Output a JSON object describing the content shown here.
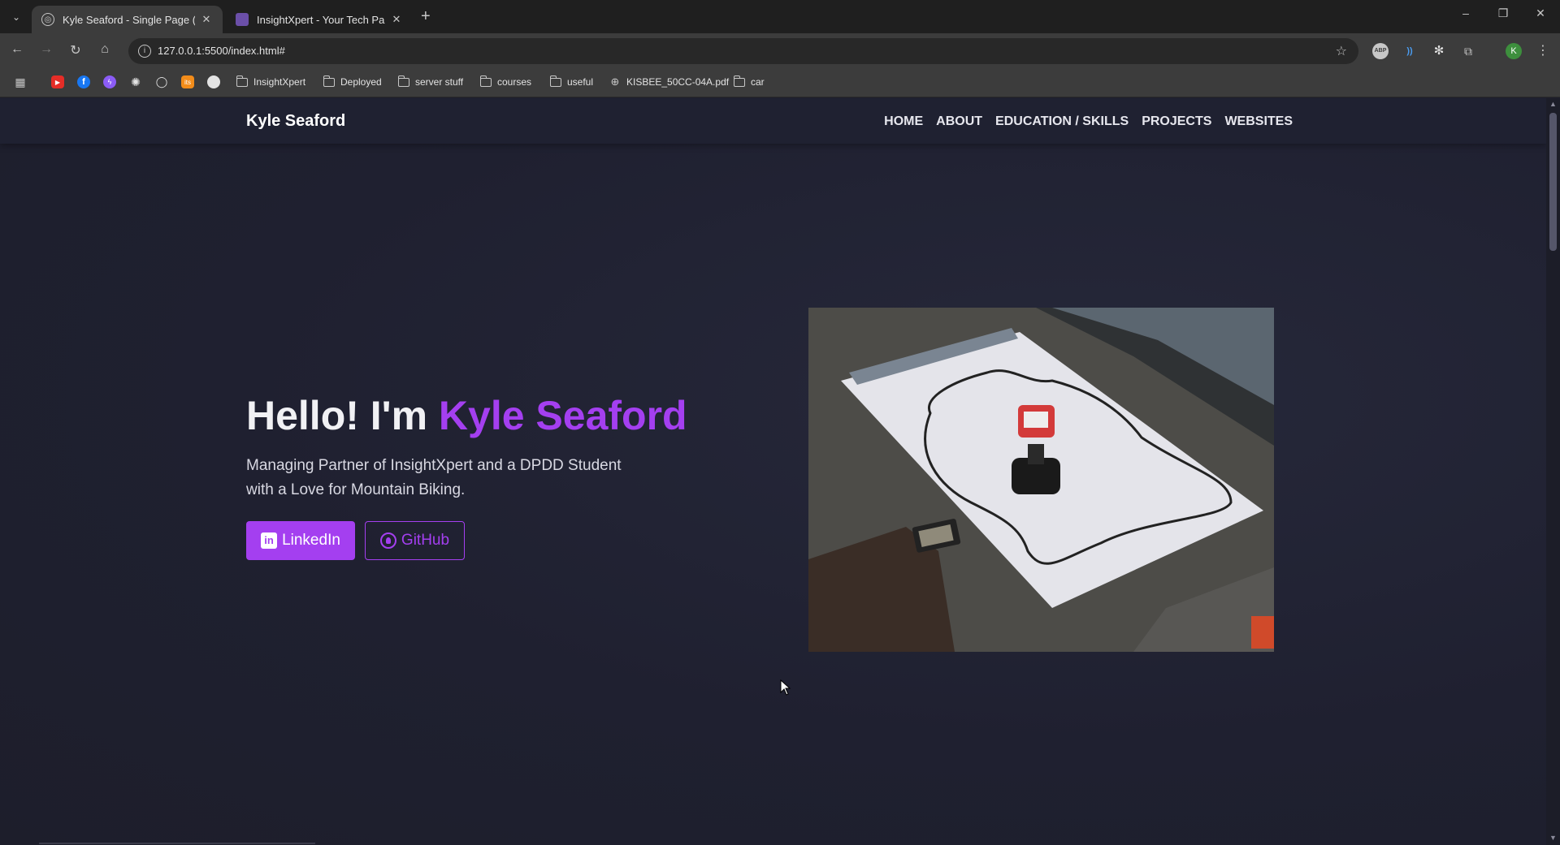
{
  "browser": {
    "tabs": [
      {
        "title": "Kyle Seaford - Single Page (Dar",
        "active": true
      },
      {
        "title": "InsightXpert - Your Tech Partner",
        "active": false
      }
    ],
    "url": "127.0.0.1:5500/index.html#",
    "profile_initial": "K",
    "bookmarks": [
      {
        "label": "InsightXpert",
        "type": "folder"
      },
      {
        "label": "Deployed",
        "type": "folder"
      },
      {
        "label": "server stuff",
        "type": "folder"
      },
      {
        "label": "courses",
        "type": "folder"
      },
      {
        "label": "useful",
        "type": "folder"
      },
      {
        "label": "KISBEE_50CC-04A.pdf",
        "type": "link"
      },
      {
        "label": "car",
        "type": "folder"
      }
    ],
    "extensions": {
      "abp": "ABP"
    }
  },
  "site": {
    "brand": "Kyle Seaford",
    "nav": [
      "HOME",
      "ABOUT",
      "EDUCATION / SKILLS",
      "PROJECTS",
      "WEBSITES"
    ],
    "hero": {
      "greeting": "Hello! I'm ",
      "name": "Kyle Seaford",
      "subtitle": "Managing Partner of InsightXpert and a DPDD Student with a Love for Mountain Biking.",
      "buttons": {
        "linkedin": "LinkedIn",
        "github": "GitHub"
      }
    },
    "accent_color": "#a43ff0",
    "background_color": "#1e1f2c"
  }
}
